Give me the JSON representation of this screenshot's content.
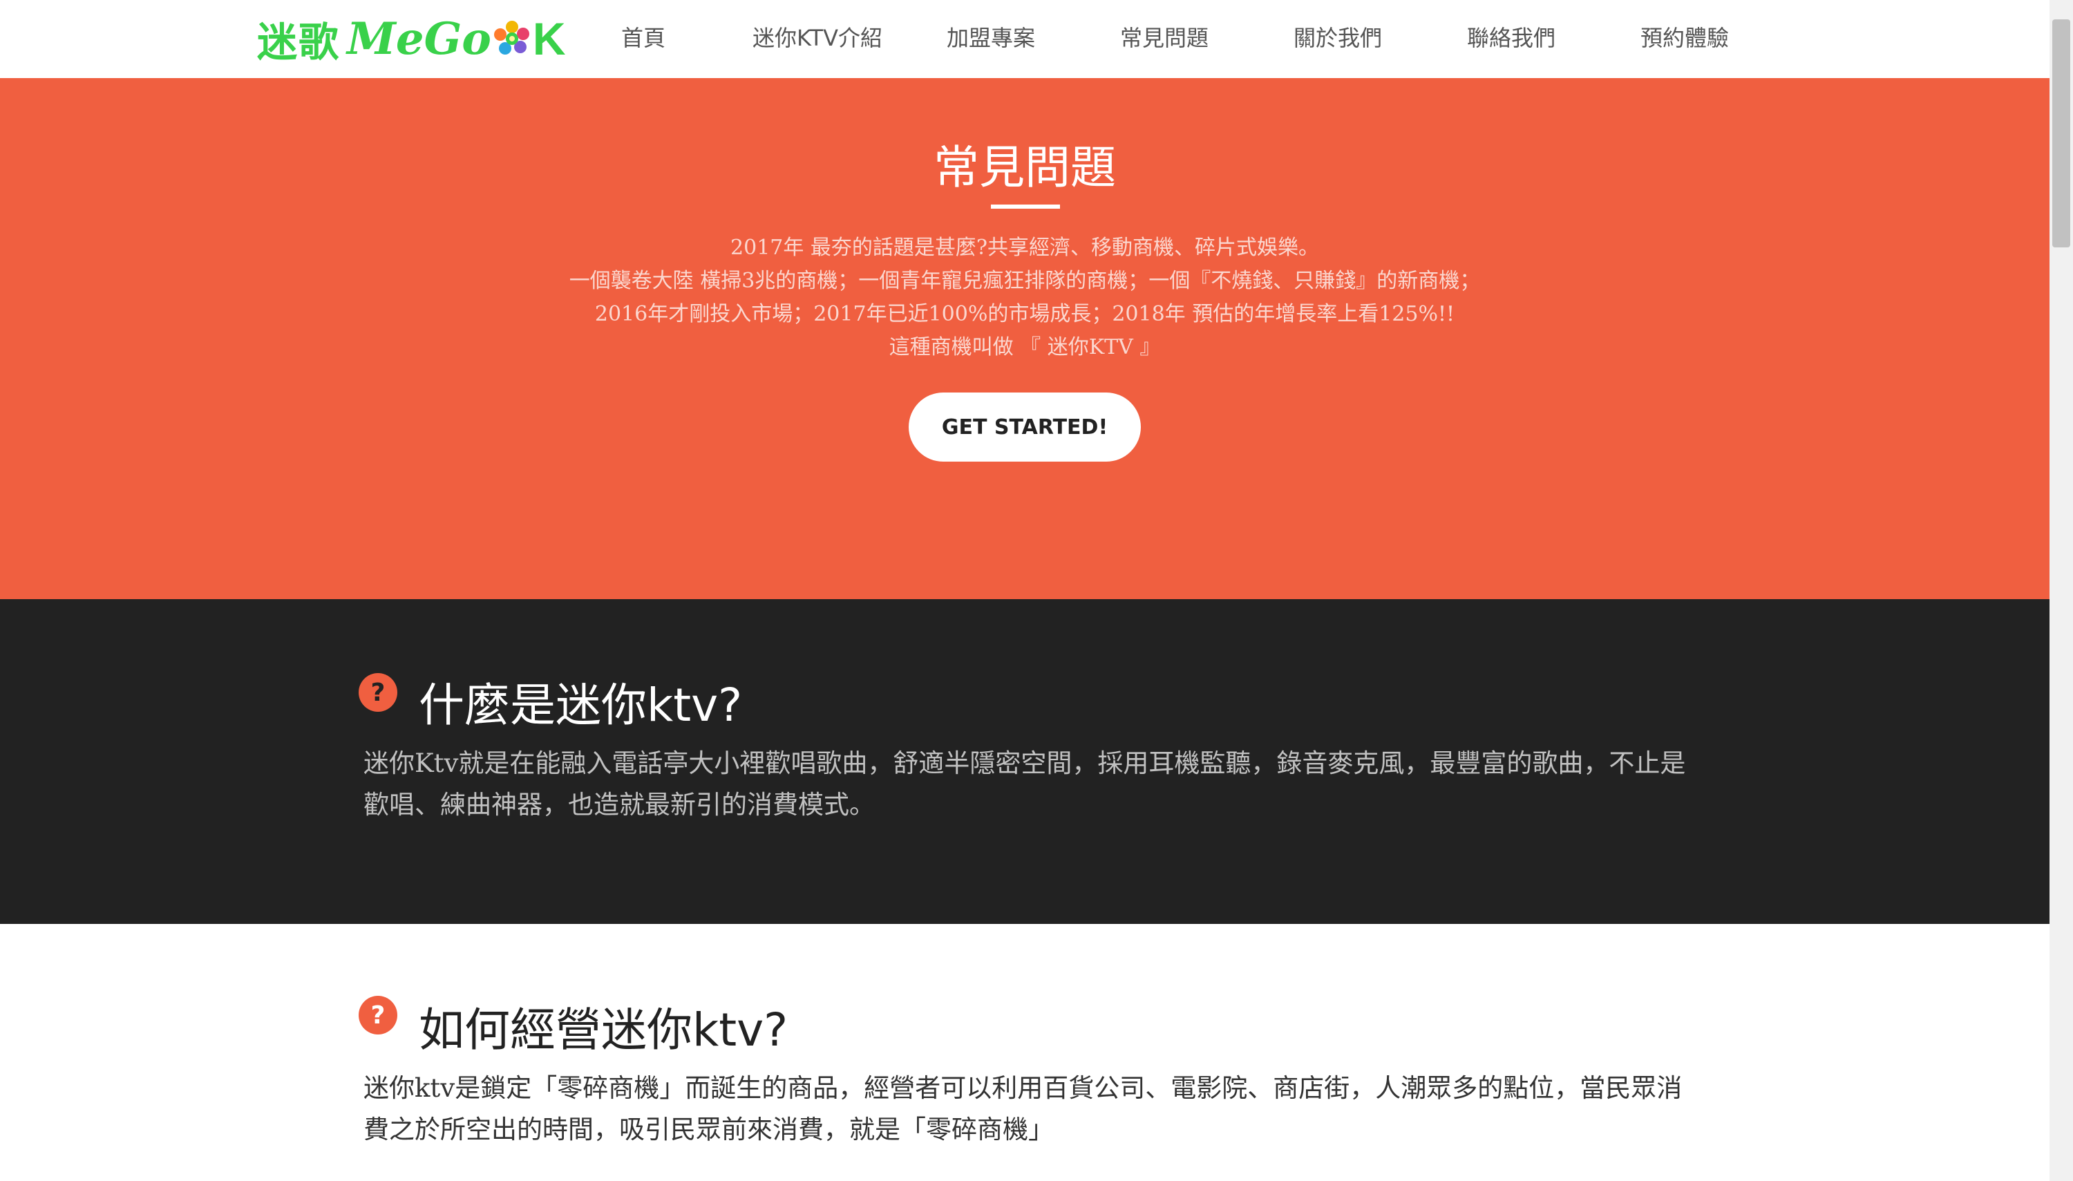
{
  "brand": {
    "logo_cn": "迷歌",
    "logo_latin": "MeGo",
    "logo_k": "K",
    "logo_color": "#39d14a"
  },
  "nav": {
    "items": [
      {
        "label": "首頁"
      },
      {
        "label": "迷你KTV介紹"
      },
      {
        "label": "加盟專案"
      },
      {
        "label": "常見問題"
      },
      {
        "label": "關於我們"
      },
      {
        "label": "聯絡我們"
      },
      {
        "label": "預約體驗"
      }
    ]
  },
  "hero": {
    "title": "常見問題",
    "lines": [
      "2017年 最夯的話題是甚麼?共享經濟、移動商機、碎片式娛樂。",
      "一個襲卷大陸 橫掃3兆的商機；一個青年寵兒瘋狂排隊的商機；一個『不燒錢、只賺錢』的新商機；",
      "2016年才剛投入市場；2017年已近100%的市場成長；2018年 預估的年增長率上看125%!!",
      "這種商機叫做 『 迷你KTV 』"
    ],
    "cta_label": "GET STARTED!",
    "background": "#f05f40"
  },
  "faq": [
    {
      "question": "什麼是迷你ktv?",
      "answer": "迷你Ktv就是在能融入電話亭大小裡歡唱歌曲，舒適半隱密空間，採用耳機監聽，錄音麥克風，最豐富的歌曲，不止是歡唱、練曲神器，也造就最新引的消費模式。"
    },
    {
      "question": "如何經營迷你ktv?",
      "answer": "迷你ktv是鎖定「零碎商機」而誕生的商品，經營者可以利用百貨公司、電影院、商店街，人潮眾多的點位，當民眾消費之於所空出的時間，吸引民眾前來消費，就是「零碎商機」"
    }
  ],
  "icons": {
    "question": "question-circle-icon",
    "flower": "flower-icon"
  },
  "colors": {
    "accent": "#f05f40",
    "dark_section": "#222222"
  }
}
